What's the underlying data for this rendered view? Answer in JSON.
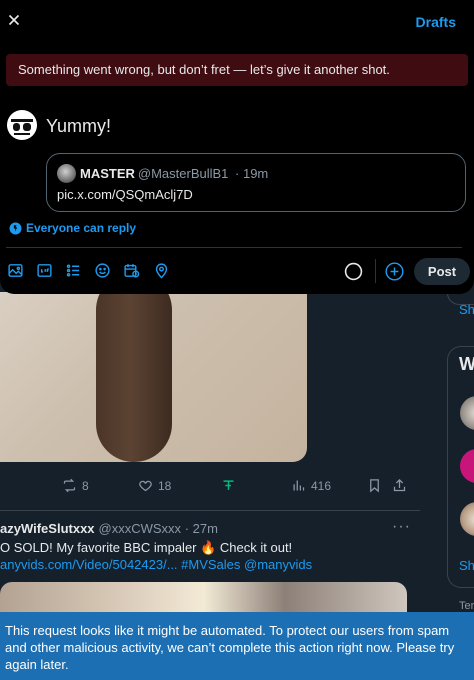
{
  "modal": {
    "drafts_label": "Drafts",
    "error_message": "Something went wrong, but don’t fret — let’s give it another shot.",
    "compose_text": "Yummy!",
    "quote": {
      "name": "MASTER",
      "handle": "@MasterBullB1",
      "time": "· 19m",
      "body": "pic.x.com/QSQmAclj7D"
    },
    "reply_setting": "Everyone can reply",
    "post_label": "Post",
    "toolbar_icons": [
      "media-icon",
      "gif-icon",
      "poll-icon",
      "emoji-icon",
      "schedule-icon",
      "location-icon"
    ]
  },
  "feed": {
    "tweet1_actions": {
      "retweets": "8",
      "likes": "18",
      "views": "416"
    },
    "tweet2": {
      "name": "azyWifeSlutxxx",
      "handle": "@xxxCWSxxx",
      "time": "· 27m",
      "more": "···",
      "text": "O SOLD! My favorite BBC impaler 🔥 Check it out!",
      "link": "anyvids.com/Video/5042423/... #MVSales @manyvids"
    }
  },
  "sidebar": {
    "show_more_1": "Sh",
    "section_title": "W",
    "show_more_2": "Sh",
    "terms": "Ter"
  },
  "toast": {
    "message": "This request looks like it might be automated. To protect our users from spam and other malicious activity, we can’t complete this action right now. Please try again later."
  },
  "colors": {
    "accent": "#1d9bf0",
    "error_bg": "#3f0d11",
    "toast_bg": "#1d6fb3",
    "bg": "#15202b",
    "modal_bg": "#000000"
  }
}
